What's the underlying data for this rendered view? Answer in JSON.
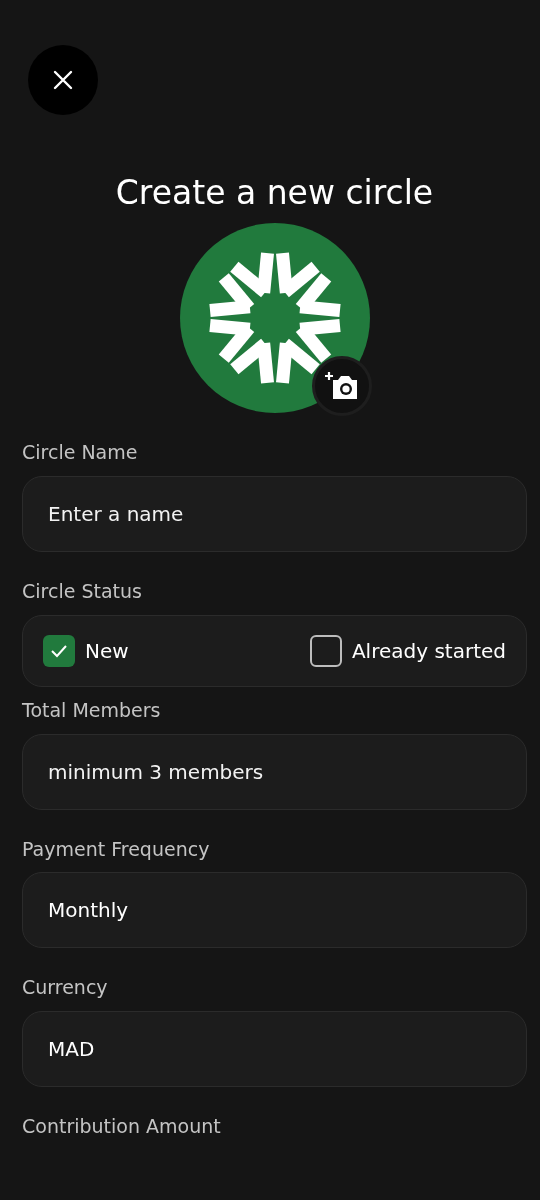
{
  "title": "Create a new circle",
  "fields": [
    {
      "kind": "text",
      "label": "Circle Name",
      "placeholder": "Enter a name"
    },
    {
      "kind": "checkboxes",
      "label": "Circle Status",
      "options": [
        {
          "label": "New",
          "checked": true
        },
        {
          "label": "Already started",
          "checked": false
        }
      ]
    },
    {
      "kind": "text",
      "label": "Total Members",
      "placeholder": "minimum 3 members"
    },
    {
      "kind": "text",
      "label": "Payment Frequency",
      "value": "Monthly"
    },
    {
      "kind": "text",
      "label": "Currency",
      "value": "MAD"
    },
    {
      "kind": "label",
      "label": "Contribution Amount"
    }
  ]
}
